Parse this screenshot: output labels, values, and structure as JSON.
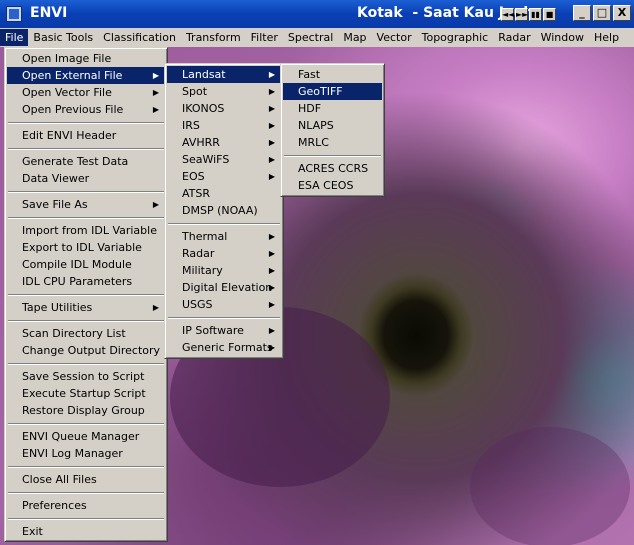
{
  "window": {
    "app_title": "ENVI",
    "subtitle": "Kotak  - Saat Kau Jauh",
    "mini_buttons": [
      "◄◄",
      "►►",
      "▮▮",
      "■"
    ],
    "controls": {
      "minimize": "_",
      "maximize": "□",
      "close": "X"
    }
  },
  "menubar": {
    "items": [
      "File",
      "Basic Tools",
      "Classification",
      "Transform",
      "Filter",
      "Spectral",
      "Map",
      "Vector",
      "Topographic",
      "Radar",
      "Window",
      "Help"
    ],
    "active": "File"
  },
  "file_menu": {
    "items": [
      {
        "label": "Open Image File"
      },
      {
        "label": "Open External File",
        "submenu": true,
        "highlighted": true
      },
      {
        "label": "Open Vector File",
        "submenu": true
      },
      {
        "label": "Open Previous File",
        "submenu": true
      },
      {
        "sep": true
      },
      {
        "label": "Edit ENVI Header"
      },
      {
        "sep": true
      },
      {
        "label": "Generate Test Data"
      },
      {
        "label": "Data Viewer"
      },
      {
        "sep": true
      },
      {
        "label": "Save File As",
        "submenu": true
      },
      {
        "sep": true
      },
      {
        "label": "Import from IDL Variable"
      },
      {
        "label": "Export to IDL Variable"
      },
      {
        "label": "Compile IDL Module"
      },
      {
        "label": "IDL CPU Parameters"
      },
      {
        "sep": true
      },
      {
        "label": "Tape Utilities",
        "submenu": true
      },
      {
        "sep": true
      },
      {
        "label": "Scan Directory List"
      },
      {
        "label": "Change Output Directory"
      },
      {
        "sep": true
      },
      {
        "label": "Save Session to Script"
      },
      {
        "label": "Execute Startup Script"
      },
      {
        "label": "Restore Display Group"
      },
      {
        "sep": true
      },
      {
        "label": "ENVI Queue Manager"
      },
      {
        "label": "ENVI Log Manager"
      },
      {
        "sep": true
      },
      {
        "label": "Close All Files"
      },
      {
        "sep": true
      },
      {
        "label": "Preferences"
      },
      {
        "sep": true
      },
      {
        "label": "Exit"
      }
    ]
  },
  "external_menu": {
    "items": [
      {
        "label": "Landsat",
        "submenu": true,
        "highlighted": true
      },
      {
        "label": "Spot",
        "submenu": true
      },
      {
        "label": "IKONOS",
        "submenu": true
      },
      {
        "label": "IRS",
        "submenu": true
      },
      {
        "label": "AVHRR",
        "submenu": true
      },
      {
        "label": "SeaWiFS",
        "submenu": true
      },
      {
        "label": "EOS",
        "submenu": true
      },
      {
        "label": "ATSR"
      },
      {
        "label": "DMSP (NOAA)"
      },
      {
        "sep": true
      },
      {
        "label": "Thermal",
        "submenu": true
      },
      {
        "label": "Radar",
        "submenu": true
      },
      {
        "label": "Military",
        "submenu": true
      },
      {
        "label": "Digital Elevation",
        "submenu": true
      },
      {
        "label": "USGS",
        "submenu": true
      },
      {
        "sep": true
      },
      {
        "label": "IP Software",
        "submenu": true
      },
      {
        "label": "Generic Formats",
        "submenu": true
      }
    ]
  },
  "landsat_menu": {
    "items": [
      {
        "label": "Fast"
      },
      {
        "label": "GeoTIFF",
        "highlighted": true
      },
      {
        "label": "HDF"
      },
      {
        "label": "NLAPS"
      },
      {
        "label": "MRLC"
      },
      {
        "sep": true
      },
      {
        "label": "ACRES CCRS"
      },
      {
        "label": "ESA CEOS"
      }
    ]
  },
  "icons": {
    "app": "envi-app-icon",
    "submenu": "triangle-right-icon"
  },
  "colors": {
    "title_bar": "#0a3fb5",
    "menu_face": "#d4d0c8",
    "highlight": "#0a246a"
  }
}
